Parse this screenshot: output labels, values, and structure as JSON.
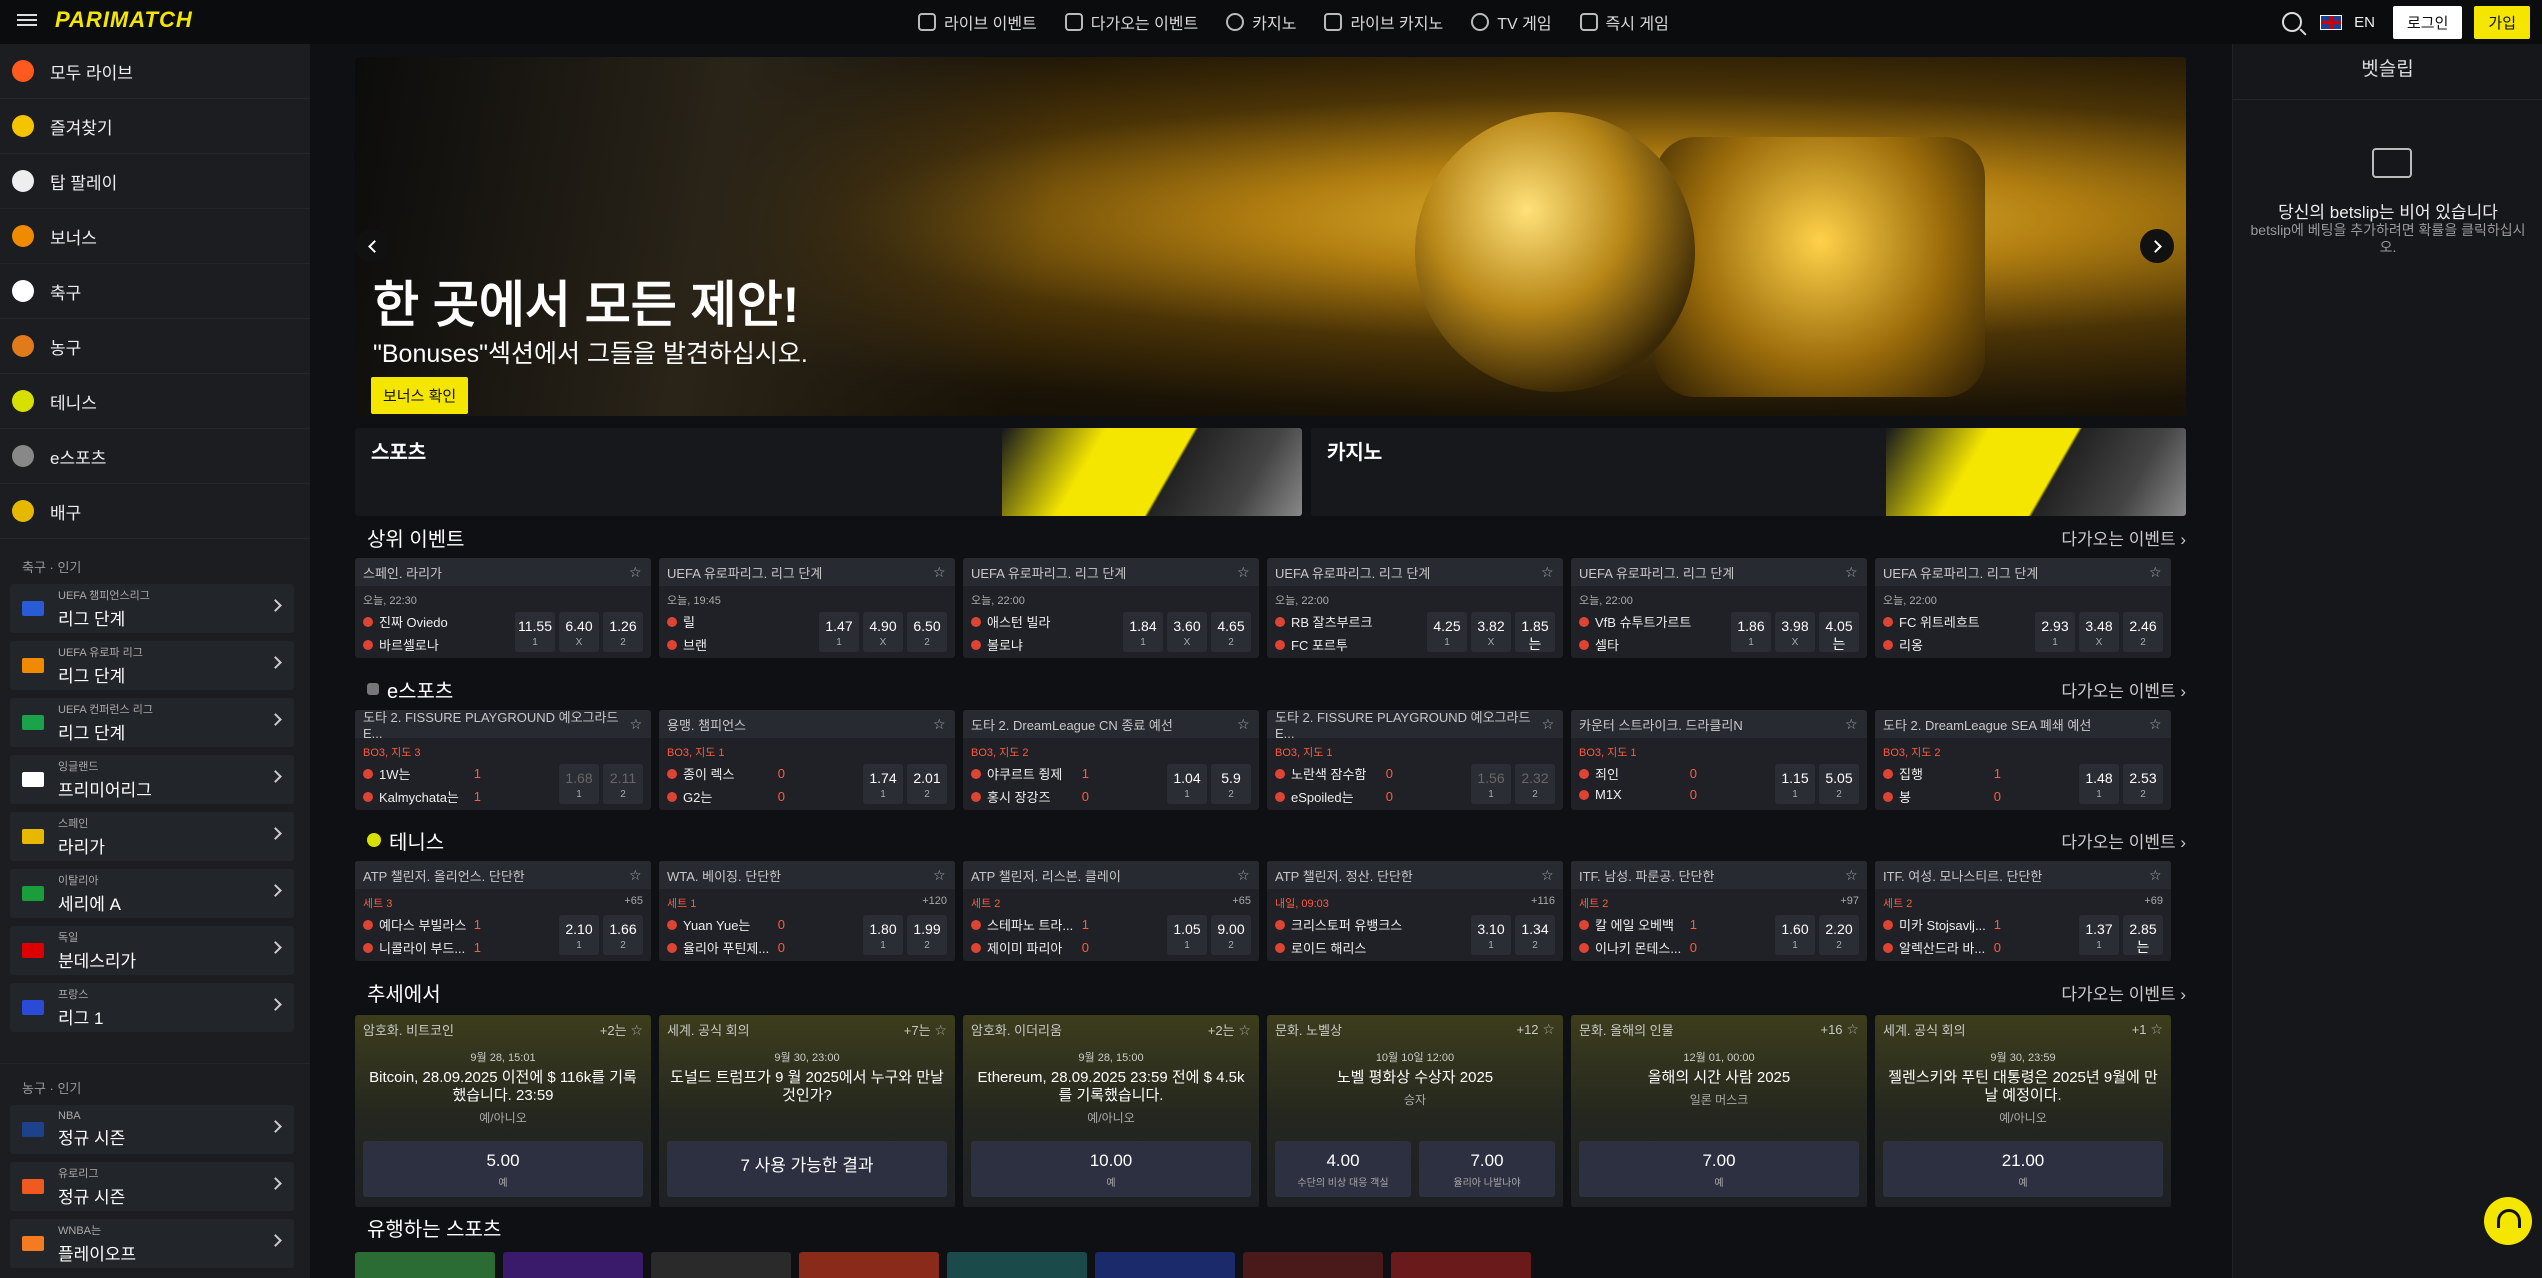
{
  "header": {
    "logo": "PARIMATCH",
    "nav": [
      "라이브 이벤트",
      "다가오는 이벤트",
      "카지노",
      "라이브 카지노",
      "TV 게임",
      "즉시 게임"
    ],
    "lang": "EN",
    "login": "로그인",
    "signup": "가입"
  },
  "sidebar": {
    "items": [
      {
        "label": "모두 라이브",
        "color": "#ff5a1e"
      },
      {
        "label": "즐겨찾기",
        "color": "#f5c400"
      },
      {
        "label": "탑 팔레이",
        "color": "#eee"
      },
      {
        "label": "보너스",
        "color": "#f08a00"
      },
      {
        "label": "축구",
        "color": "#fff"
      },
      {
        "label": "농구",
        "color": "#e07a1a"
      },
      {
        "label": "테니스",
        "color": "#d7e000"
      },
      {
        "label": "e스포츠",
        "color": "#888"
      },
      {
        "label": "배구",
        "color": "#e6b800"
      }
    ],
    "football_label": "축구 · 인기",
    "football": [
      {
        "t1": "UEFA 챔피언스리그",
        "t2": "리그 단계",
        "color": "#2a5bd7"
      },
      {
        "t1": "UEFA 유로파 리그",
        "t2": "리그 단계",
        "color": "#f08a00"
      },
      {
        "t1": "UEFA 컨퍼런스 리그",
        "t2": "리그 단계",
        "color": "#1aa34a"
      },
      {
        "t1": "잉글랜드",
        "t2": "프리미어리그",
        "color": "#ffffff"
      },
      {
        "t1": "스페인",
        "t2": "라리가",
        "color": "#e8b800"
      },
      {
        "t1": "이탈리아",
        "t2": "세리에 A",
        "color": "#1a9e3b"
      },
      {
        "t1": "독일",
        "t2": "분데스리가",
        "color": "#dd0000"
      },
      {
        "t1": "프랑스",
        "t2": "리그 1",
        "color": "#2a4bd7"
      }
    ],
    "basketball_label": "농구 · 인기",
    "basketball": [
      {
        "t1": "NBA",
        "t2": "정규 시즌",
        "color": "#1d428a"
      },
      {
        "t1": "유로리그",
        "t2": "정규 시즌",
        "color": "#f05a1e"
      },
      {
        "t1": "WNBA는",
        "t2": "플레이오프",
        "color": "#f57b20"
      }
    ]
  },
  "hero": {
    "title": "한 곳에서 모든 제안!",
    "subtitle": "\"Bonuses\"섹션에서 그들을 발견하십시오.",
    "cta": "보너스 확인"
  },
  "promos": {
    "sports": "스포츠",
    "casino": "카지노"
  },
  "sections": {
    "top": "상위 이벤트",
    "esports": "e스포츠",
    "tennis": "테니스",
    "trends": "추세에서",
    "popular": "유행하는 스포츠",
    "more": "다가오는 이벤트"
  },
  "top_events": [
    {
      "league": "스페인. 라리가",
      "time": "오늘, 22:30",
      "home": "진짜 Oviedo",
      "away": "바르셀로나",
      "odds": [
        "11.55",
        "6.40",
        "1.26"
      ],
      "labels": [
        "1",
        "X",
        "2"
      ]
    },
    {
      "league": "UEFA 유로파리그. 리그 단계",
      "time": "오늘, 19:45",
      "home": "릴",
      "away": "브랜",
      "odds": [
        "1.47",
        "4.90",
        "6.50"
      ],
      "labels": [
        "1",
        "X",
        "2"
      ]
    },
    {
      "league": "UEFA 유로파리그. 리그 단계",
      "time": "오늘, 22:00",
      "home": "애스턴 빌라",
      "away": "볼로냐",
      "odds": [
        "1.84",
        "3.60",
        "4.65"
      ],
      "labels": [
        "1",
        "X",
        "2"
      ]
    },
    {
      "league": "UEFA 유로파리그. 리그 단계",
      "time": "오늘, 22:00",
      "home": "RB 잘츠부르크",
      "away": "FC 포르투",
      "odds": [
        "4.25",
        "3.82",
        "1.85는"
      ],
      "labels": [
        "1",
        "X",
        "2"
      ]
    },
    {
      "league": "UEFA 유로파리그. 리그 단계",
      "time": "오늘, 22:00",
      "home": "VfB 슈투트가르트",
      "away": "셀타",
      "odds": [
        "1.86",
        "3.98",
        "4.05는"
      ],
      "labels": [
        "1",
        "X",
        "2"
      ]
    },
    {
      "league": "UEFA 유로파리그. 리그 단계",
      "time": "오늘, 22:00",
      "home": "FC 위트레흐트",
      "away": "리옹",
      "odds": [
        "2.93",
        "3.48",
        "2.46"
      ],
      "labels": [
        "1",
        "X",
        "2"
      ]
    }
  ],
  "esports_events": [
    {
      "league": "도타 2. FISSURE PLAYGROUND 예오그라드 E...",
      "meta": "BO3, 지도 3",
      "home": "1W는",
      "away": "Kalmychata는",
      "s1": "1",
      "s2": "1",
      "odds": [
        "1.68",
        "2.11"
      ],
      "dim": true
    },
    {
      "league": "용맹. 챔피언스",
      "meta": "BO3, 지도 1",
      "home": "종이 렉스",
      "away": "G2는",
      "s1": "0",
      "s2": "0",
      "odds": [
        "1.74",
        "2.01"
      ],
      "dim": false
    },
    {
      "league": "도타 2. DreamLeague CN 종료 예선",
      "meta": "BO3, 지도 2",
      "home": "야쿠르트 쥥제",
      "away": "홍시 장강즈",
      "s1": "1",
      "s2": "0",
      "odds": [
        "1.04",
        "5.9"
      ],
      "dim": false
    },
    {
      "league": "도타 2. FISSURE PLAYGROUND 예오그라드 E...",
      "meta": "BO3, 지도 1",
      "home": "노란색 잠수함",
      "away": "eSpoiled는",
      "s1": "0",
      "s2": "0",
      "odds": [
        "1.56",
        "2.32"
      ],
      "dim": true
    },
    {
      "league": "카운터 스트라이크. 드라클리N",
      "meta": "BO3, 지도 1",
      "home": "죄인",
      "away": "M1X",
      "s1": "0",
      "s2": "0",
      "odds": [
        "1.15",
        "5.05"
      ],
      "dim": false
    },
    {
      "league": "도타 2. DreamLeague SEA 폐쇄 예선",
      "meta": "BO3, 지도 2",
      "home": "집행",
      "away": "봉",
      "s1": "1",
      "s2": "0",
      "odds": [
        "1.48",
        "2.53"
      ],
      "dim": false
    }
  ],
  "tennis_events": [
    {
      "league": "ATP 챌린저. 올리언스. 단단한",
      "meta": "세트 3",
      "extra": "+65",
      "home": "예다스 부빌라스",
      "away": "니콜라이 부드...",
      "s1": "1",
      "s2": "1",
      "odds": [
        "2.10",
        "1.66"
      ]
    },
    {
      "league": "WTA. 베이징. 단단한",
      "meta": "세트 1",
      "extra": "+120",
      "home": "Yuan Yue는",
      "away": "율리아 푸틴제...",
      "s1": "0",
      "s2": "0",
      "odds": [
        "1.80",
        "1.99"
      ]
    },
    {
      "league": "ATP 챌린저. 리스본. 클레이",
      "meta": "세트 2",
      "extra": "+65",
      "home": "스테파노 트라...",
      "away": "제이미 파리아",
      "s1": "1",
      "s2": "0",
      "odds": [
        "1.05",
        "9.00"
      ]
    },
    {
      "league": "ATP 챌린저. 정산. 단단한",
      "meta": "내일, 09:03",
      "extra": "+116",
      "home": "크리스토퍼 유뱅크스",
      "away": "로이드 해리스",
      "s1": "",
      "s2": "",
      "odds": [
        "3.10",
        "1.34"
      ]
    },
    {
      "league": "ITF. 남성. 파룬공. 단단한",
      "meta": "세트 2",
      "extra": "+97",
      "home": "칼 에일 오베백",
      "away": "이나키 몬테스...",
      "s1": "1",
      "s2": "0",
      "odds": [
        "1.60",
        "2.20"
      ]
    },
    {
      "league": "ITF. 여성. 모나스티르. 단단한",
      "meta": "세트 2",
      "extra": "+69",
      "home": "미카 Stojsavlj...",
      "away": "알렉산드라 바...",
      "s1": "1",
      "s2": "0",
      "odds": [
        "1.37",
        "2.85는"
      ]
    }
  ],
  "trends": [
    {
      "cat": "암호화. 비트코인",
      "extra": "+2는",
      "date": "9월 28, 15:01",
      "q": "Bitcoin, 28.09.2025 이전에 $ 116k를 기록했습니다. 23:59",
      "qs": "예/아니오",
      "bets": [
        {
          "v": "5.00",
          "l": "예"
        }
      ]
    },
    {
      "cat": "세계. 공식 회의",
      "extra": "+7는",
      "date": "9월 30, 23:00",
      "q": "도널드 트럼프가 9 월 2025에서 누구와 만날 것인가?",
      "qs": "",
      "bets": [
        {
          "v": "7 사용 가능한 결과",
          "l": ""
        }
      ]
    },
    {
      "cat": "암호화. 이더리움",
      "extra": "+2는",
      "date": "9월 28, 15:00",
      "q": "Ethereum, 28.09.2025 23:59 전에 $ 4.5k를 기록했습니다.",
      "qs": "예/아니오",
      "bets": [
        {
          "v": "10.00",
          "l": "예"
        }
      ]
    },
    {
      "cat": "문화. 노벨상",
      "extra": "+12",
      "date": "10월 10일 12:00",
      "q": "노벨 평화상 수상자 2025",
      "qs": "승자",
      "bets": [
        {
          "v": "4.00",
          "l": "수단의 비상 대응 객실"
        },
        {
          "v": "7.00",
          "l": "율리아 나발나야"
        }
      ]
    },
    {
      "cat": "문화. 올해의 인물",
      "extra": "+16",
      "date": "12월 01, 00:00",
      "q": "올해의 시간 사람 2025",
      "qs": "일론 머스크",
      "bets": [
        {
          "v": "7.00",
          "l": "예"
        }
      ]
    },
    {
      "cat": "세계. 공식 회의",
      "extra": "+1",
      "date": "9월 30, 23:59",
      "q": "젤렌스키와 푸틴 대통령은 2025년 9월에 만날 예정이다.",
      "qs": "예/아니오",
      "bets": [
        {
          "v": "21.00",
          "l": "예"
        }
      ]
    }
  ],
  "betslip": {
    "title": "벳슬립",
    "empty_title": "당신의 betslip는 비어 있습니다",
    "empty_desc": "betslip에 베팅을 추가하려면 확률을 클릭하십시오."
  },
  "popular_colors": [
    "#2b6b34",
    "#3a1a6a",
    "#2a2a2a",
    "#8a2a1a",
    "#1a4a4a",
    "#1a2a6a",
    "#4a1a1a",
    "#6a1a1a"
  ]
}
